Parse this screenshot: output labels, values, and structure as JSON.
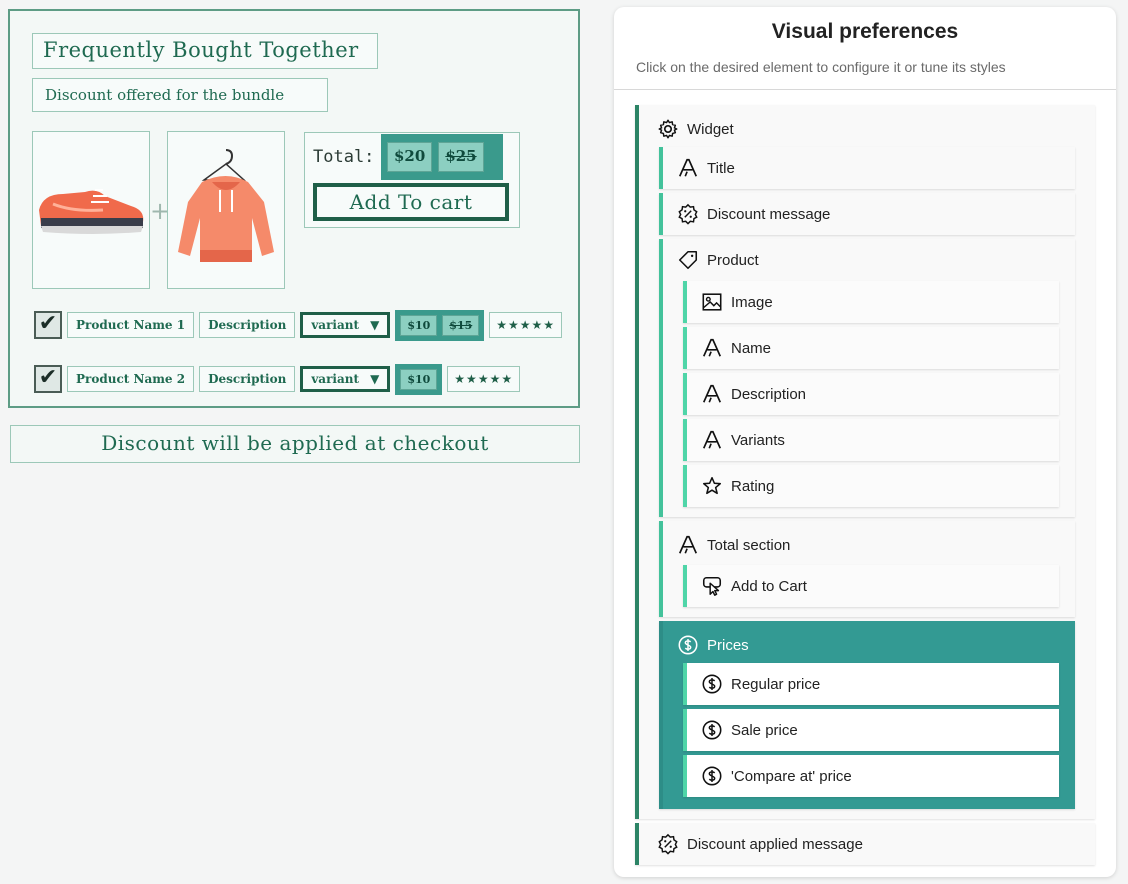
{
  "mockup": {
    "title": "Frequently Bought Together",
    "subtitle": "Discount offered for the bundle",
    "plus": "+",
    "total_label": "Total:",
    "total_price": "$20",
    "total_compare": "$25",
    "add_to_cart": "Add To cart",
    "products": [
      {
        "checked": "✔",
        "name": "Product Name 1",
        "description": "Description",
        "variant": "variant",
        "variant_arrow": "▼",
        "price": "$10",
        "compare": "$15",
        "stars": "★★★★★"
      },
      {
        "checked": "✔",
        "name": "Product Name 2",
        "description": "Description",
        "variant": "variant",
        "variant_arrow": "▼",
        "price": "$10",
        "stars": "★★★★★"
      }
    ],
    "checkout_message": "Discount will be applied at checkout",
    "colors": {
      "accent": "#3a9a8c",
      "ink": "#1f6a51",
      "shoe": "#f06a4b",
      "hoodie": "#f58a6a"
    }
  },
  "panel": {
    "title": "Visual preferences",
    "subtitle": "Click on the desired element to configure it or tune its styles",
    "tree": {
      "widget": {
        "label": "Widget",
        "icon": "gear-icon"
      },
      "title": {
        "label": "Title",
        "icon": "font-icon"
      },
      "discount_message": {
        "label": "Discount message",
        "icon": "discount-badge-icon"
      },
      "product": {
        "label": "Product",
        "icon": "tag-icon"
      },
      "image": {
        "label": "Image",
        "icon": "image-icon"
      },
      "name": {
        "label": "Name",
        "icon": "font-icon"
      },
      "description": {
        "label": "Description",
        "icon": "font-icon"
      },
      "variants": {
        "label": "Variants",
        "icon": "font-icon"
      },
      "rating": {
        "label": "Rating",
        "icon": "star-icon"
      },
      "total_section": {
        "label": "Total section",
        "icon": "font-icon"
      },
      "add_to_cart": {
        "label": "Add to Cart",
        "icon": "button-pointer-icon"
      },
      "prices": {
        "label": "Prices",
        "icon": "dollar-circle-icon"
      },
      "regular_price": {
        "label": "Regular price",
        "icon": "dollar-circle-icon"
      },
      "sale_price": {
        "label": "Sale price",
        "icon": "dollar-circle-icon"
      },
      "compare_price": {
        "label": "'Compare at' price",
        "icon": "dollar-circle-icon"
      },
      "discount_applied": {
        "label": "Discount applied message",
        "icon": "discount-badge-icon"
      }
    },
    "colors": {
      "primary_border": "#2c8466",
      "active_bg": "#339a93",
      "leaf_border": "#4fd5a8"
    }
  }
}
